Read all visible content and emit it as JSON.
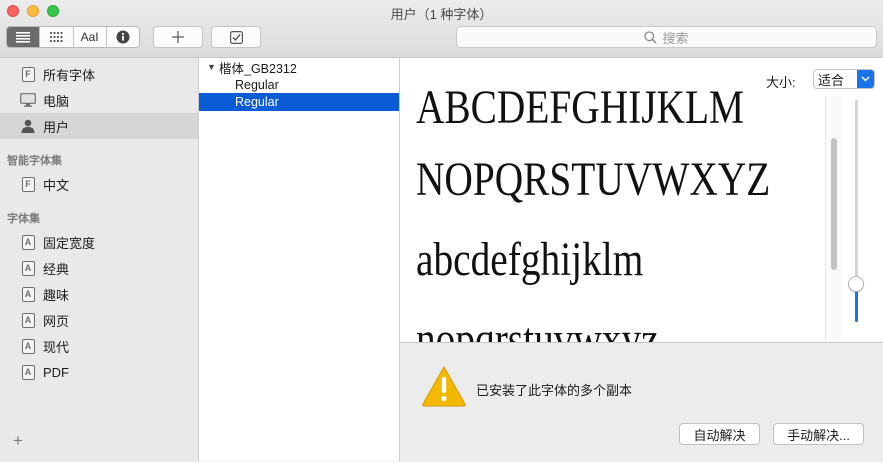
{
  "window": {
    "title": "用户（1 种字体）"
  },
  "toolbar": {
    "view_modes": [
      "list-icon",
      "grid-icon",
      "sample-text-icon",
      "info-icon"
    ],
    "sample_text_label": "AaI",
    "add_icon": "plus-icon",
    "validate_icon": "checkbox-icon",
    "search_placeholder": "搜索"
  },
  "sidebar": {
    "top_items": [
      {
        "label": "所有字体",
        "icon": "font-doc-icon",
        "icon_letter": "F"
      },
      {
        "label": "电脑",
        "icon": "computer-icon"
      },
      {
        "label": "用户",
        "icon": "user-icon",
        "selected": true
      }
    ],
    "smart_section_title": "智能字体集",
    "smart_items": [
      {
        "label": "中文",
        "icon": "font-doc-icon",
        "icon_letter": "F"
      }
    ],
    "collections_title": "字体集",
    "collection_items": [
      {
        "label": "固定宽度",
        "icon_letter": "A"
      },
      {
        "label": "经典",
        "icon_letter": "A"
      },
      {
        "label": "趣味",
        "icon_letter": "A"
      },
      {
        "label": "网页",
        "icon_letter": "A"
      },
      {
        "label": "现代",
        "icon_letter": "A"
      },
      {
        "label": "PDF",
        "icon_letter": "A"
      }
    ],
    "add_label": "+"
  },
  "font_list": {
    "family": "楷体_GB2312",
    "faces": [
      {
        "label": "Regular",
        "selected": false
      },
      {
        "label": "Regular",
        "selected": true
      }
    ],
    "selected_color": "#0a5bd6"
  },
  "preview": {
    "size_label": "大小:",
    "size_value": "适合",
    "lines": [
      "ABCDEFGHIJKLM",
      "NOPQRSTUVWXYZ",
      "abcdefghijklm",
      "nopqrstuvwxyz"
    ],
    "size_slider_level": 0.17
  },
  "warning": {
    "message": "已安装了此字体的多个副本",
    "auto_resolve": "自动解决",
    "manual_resolve": "手动解决...",
    "icon_color": "#f5b800"
  }
}
